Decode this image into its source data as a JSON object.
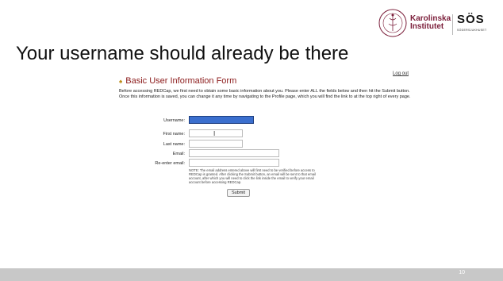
{
  "slide": {
    "headline": "Your username should already be there",
    "page_number": "10"
  },
  "logos": {
    "ki_line1": "Karolinska",
    "ki_line2": "Institutet",
    "sos_mark": "SÖS",
    "sos_sub": "SÖDERSJUKHUSET"
  },
  "form": {
    "logout_label": "Log out",
    "title": "Basic User Information Form",
    "intro": "Before accessing REDCap, we first need to obtain some basic information about you. Please enter ALL the fields below and then hit the Submit button. Once this information is saved, you can change it any time by navigating to the Profile page, which you will find the link to at the top right of every page.",
    "labels": {
      "username": "Username:",
      "first_name": "First name:",
      "last_name": "Last name:",
      "email": "Email:",
      "reenter_email": "Re-enter email:"
    },
    "note": "NOTE: The email address entered above will first need to be verified before access to REDCap is granted. After clicking the Submit button, an email will be sent to that email account, after which you will need to click the link inside the email to verify your email account before accessing REDCap.",
    "submit_label": "Submit"
  }
}
